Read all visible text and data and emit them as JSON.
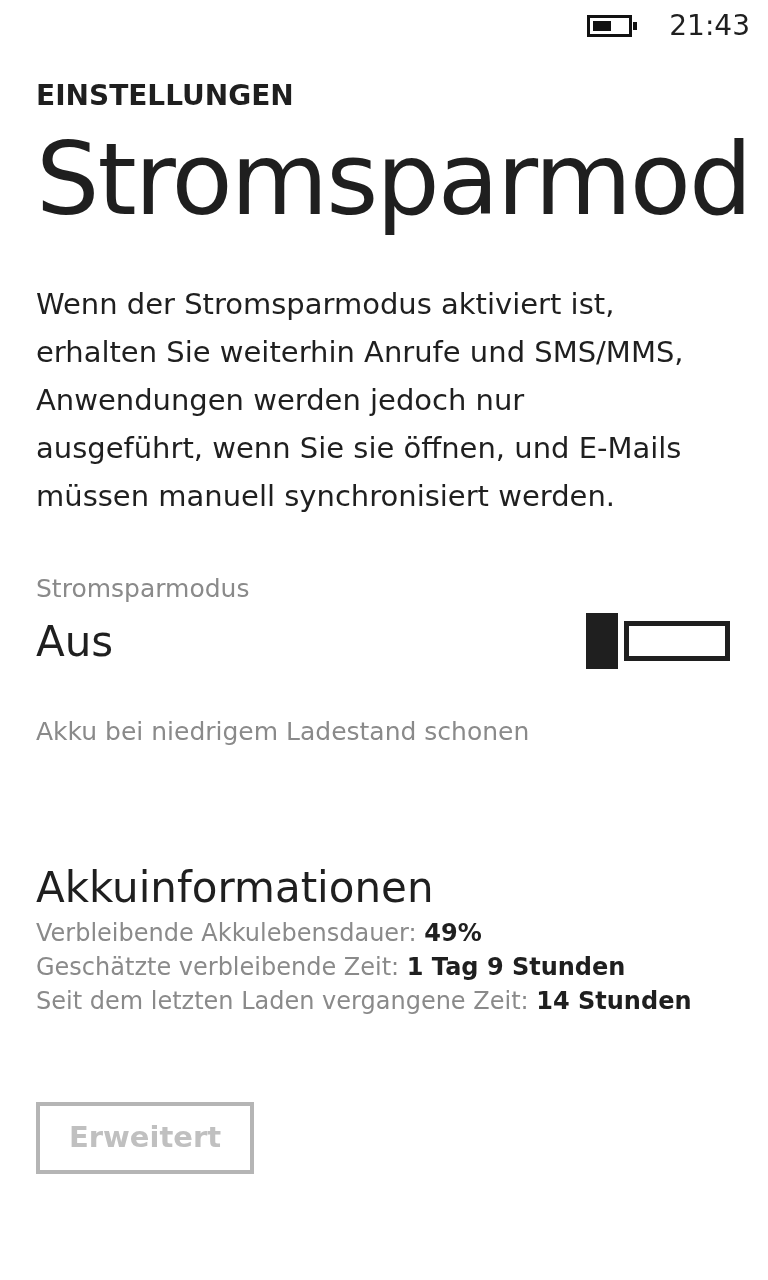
{
  "status_bar": {
    "time": "21:43"
  },
  "header": {
    "app": "EINSTELLUNGEN",
    "title": "Stromsparmod"
  },
  "description": "Wenn der Stromsparmodus aktiviert ist, erhalten Sie weiterhin Anrufe und SMS/MMS, Anwendungen werden jedoch nur ausgeführt, wenn Sie sie öffnen, und E-Mails müssen manuell synchronisiert werden.",
  "toggle": {
    "label": "Stromsparmodus",
    "value": "Aus",
    "on": false,
    "hint": "Akku bei niedrigem Ladestand schonen"
  },
  "battery_info": {
    "heading": "Akkuinformationen",
    "lines": [
      "Verbleibende Akkulebensdauer: **49%**",
      "Geschätzte verbleibende Zeit: **1 Tag 9 Stunden**",
      "Seit dem letzten Laden vergangene Zeit: **14 Stunden**"
    ]
  },
  "button": {
    "label": "Erweitert",
    "disabled": true
  }
}
